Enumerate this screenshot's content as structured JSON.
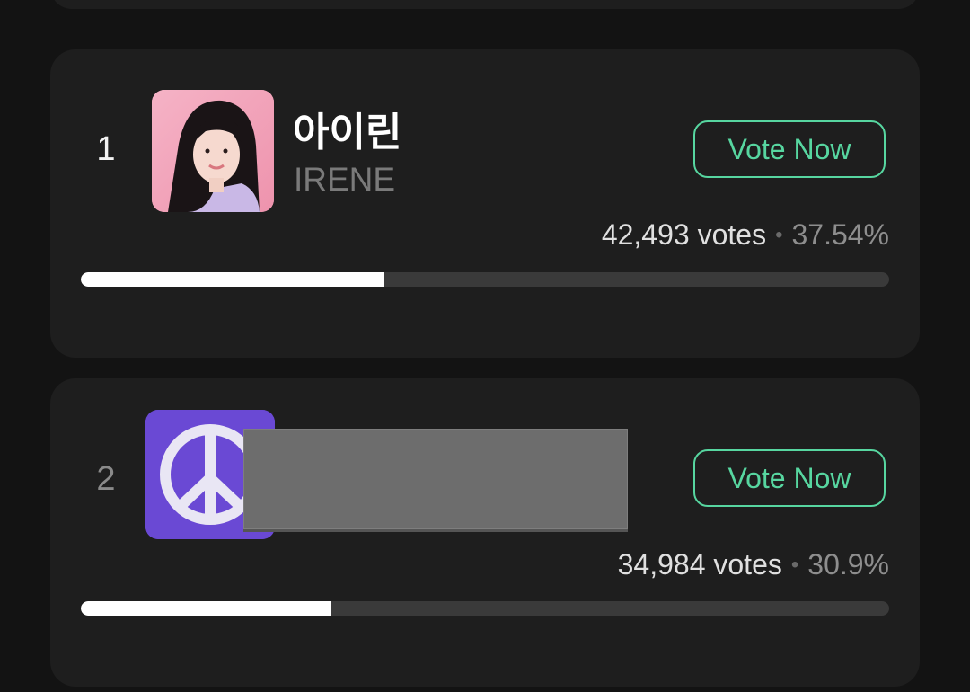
{
  "entries": [
    {
      "rank": "1",
      "name": "아이린",
      "subname": "IRENE",
      "vote_label": "Vote Now",
      "votes": "42,493 votes",
      "separator": "•",
      "percent": "37.54%",
      "progress_fraction": 0.3754
    },
    {
      "rank": "2",
      "vote_label": "Vote Now",
      "votes": "34,984 votes",
      "separator": "•",
      "percent": "30.9%",
      "progress_fraction": 0.309
    }
  ],
  "colors": {
    "background": "#131313",
    "card": "#1e1e1e",
    "accent": "#57d6a0",
    "progress_fill": "#ffffff",
    "progress_track": "#3a3a3a"
  },
  "icons": {
    "avatar_2": "peace-sign-icon"
  }
}
